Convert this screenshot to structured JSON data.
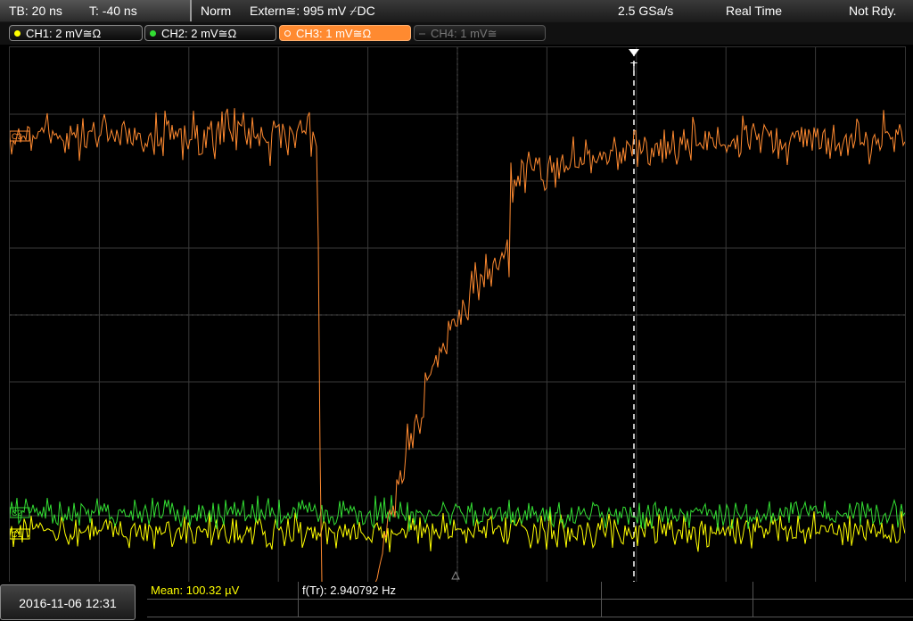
{
  "topbar": {
    "timebase": "TB: 20 ns",
    "trigger_time": "T: -40 ns",
    "trigger_mode": "Norm",
    "trigger_source": "Extern≅: 995 mV ⌿DC",
    "sample_rate": "2.5 GSa/s",
    "acq_mode": "Real Time",
    "status": "Not Rdy."
  },
  "channels": [
    {
      "label": "CH1: 2 mV≅Ω",
      "color": "#ffff00"
    },
    {
      "label": "CH2: 2 mV≅Ω",
      "color": "#33dd33"
    },
    {
      "label": "CH3: 1 mV≅Ω",
      "color": "#ff8a30"
    },
    {
      "label": "CH4: 1 mV≅",
      "color": "#777777"
    }
  ],
  "markers": {
    "ch3": "C3",
    "ch2": "C2",
    "ch1": "C1",
    "trigger": "T"
  },
  "footer": {
    "datetime": "2016-11-06 12:31",
    "mean": "Mean: 100.32 µV",
    "freq": "f(Tr): 2.940792 Hz"
  }
}
